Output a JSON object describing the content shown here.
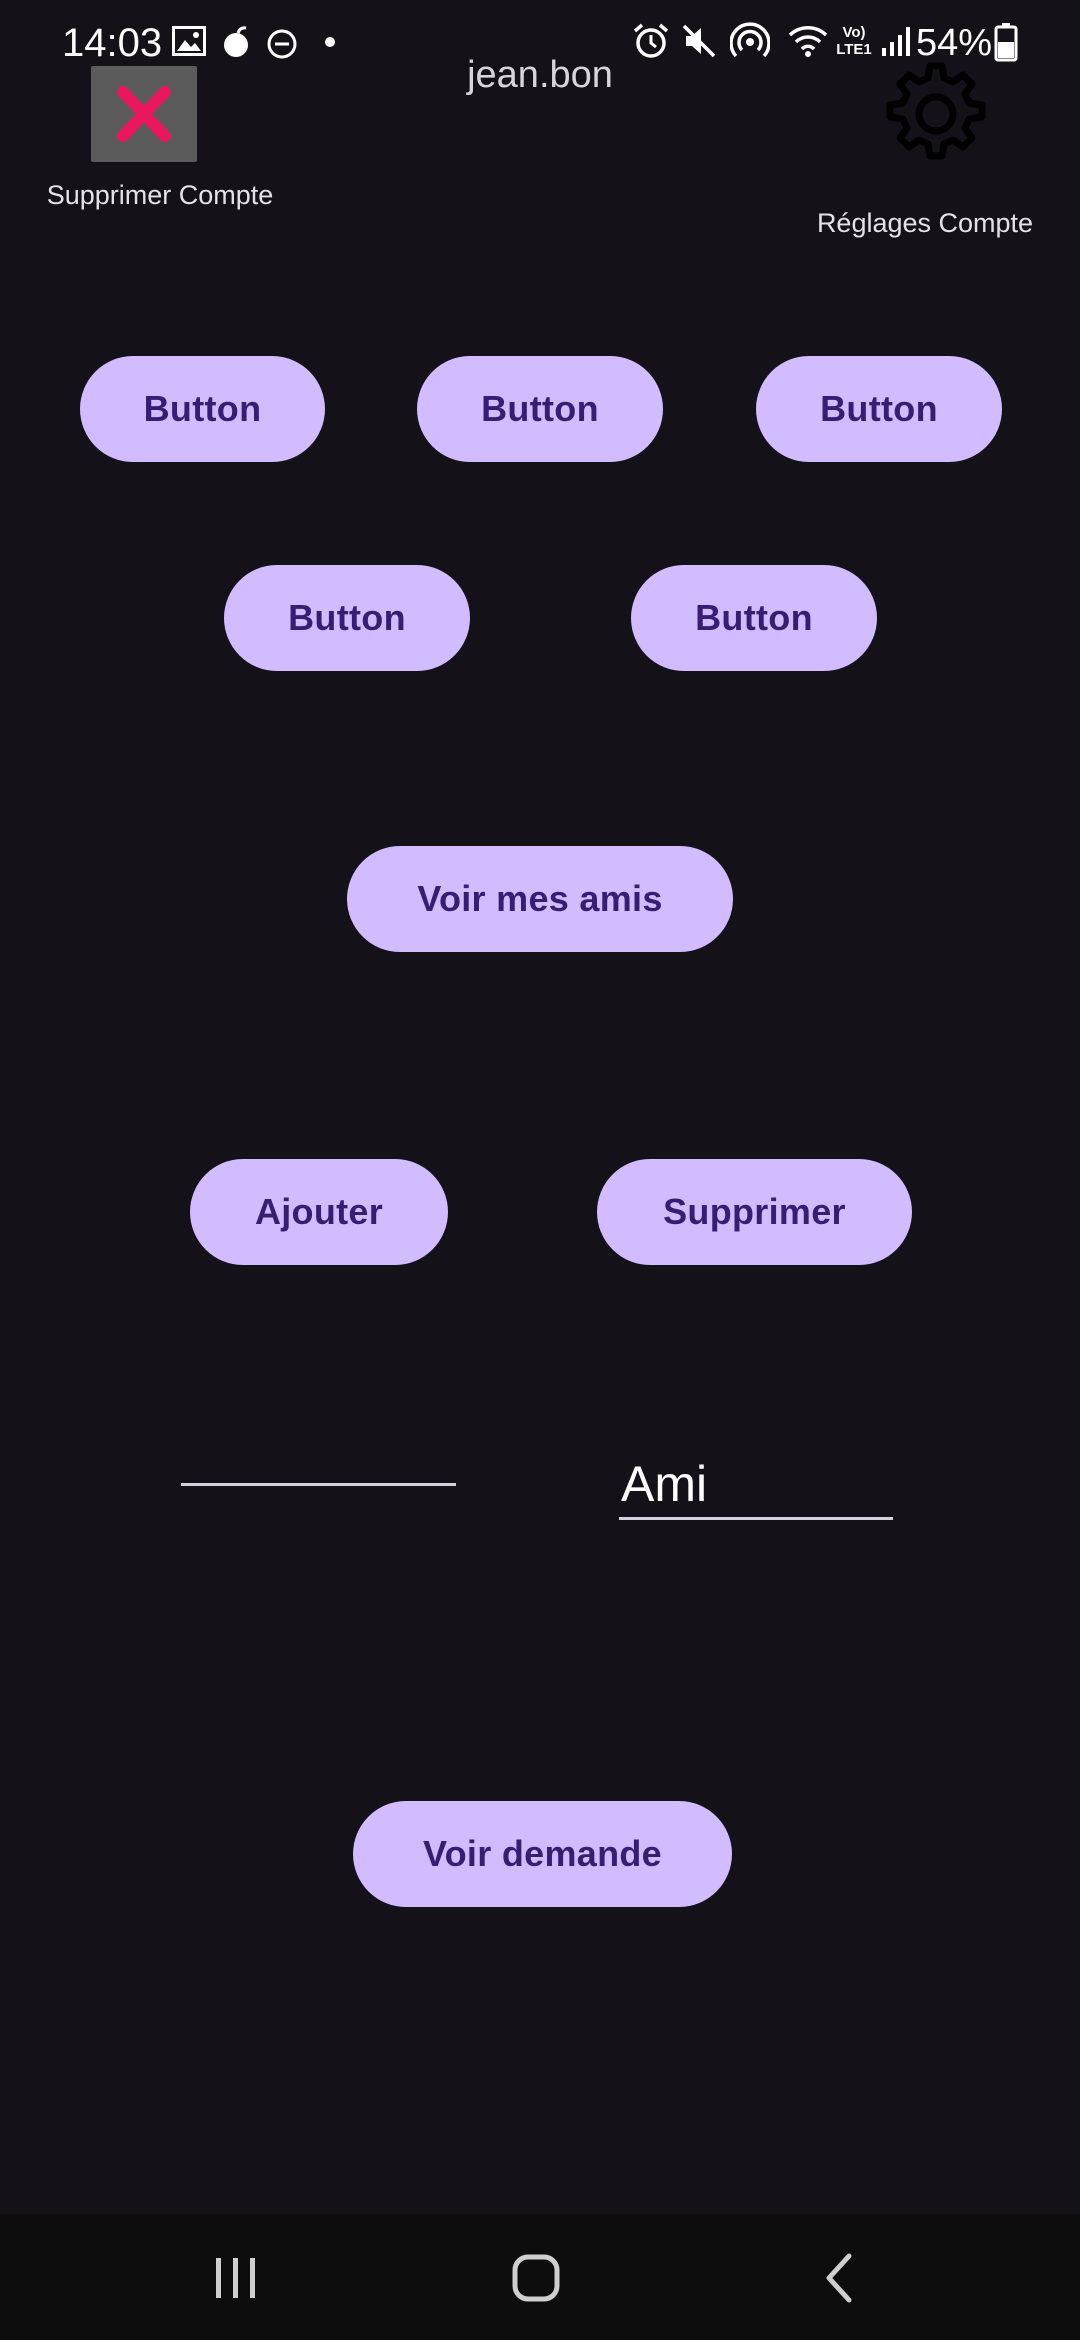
{
  "status_bar": {
    "time": "14:03",
    "battery": "54%",
    "network_label": "Vo) LTE1"
  },
  "header": {
    "username": "jean.bon",
    "delete_account_label": "Supprimer Compte",
    "settings_label": "Réglages Compte"
  },
  "buttons": {
    "row1": [
      "Button",
      "Button",
      "Button"
    ],
    "row2": [
      "Button",
      "Button"
    ],
    "see_friends": "Voir mes amis",
    "add": "Ajouter",
    "remove": "Supprimer",
    "see_requests": "Voir demande"
  },
  "inputs": {
    "left_value": "",
    "friend_value": "Ami"
  },
  "colors": {
    "background": "#141218",
    "button_bg": "#d0bcff",
    "button_text": "#381e72",
    "delete_icon": "#e8175d"
  }
}
